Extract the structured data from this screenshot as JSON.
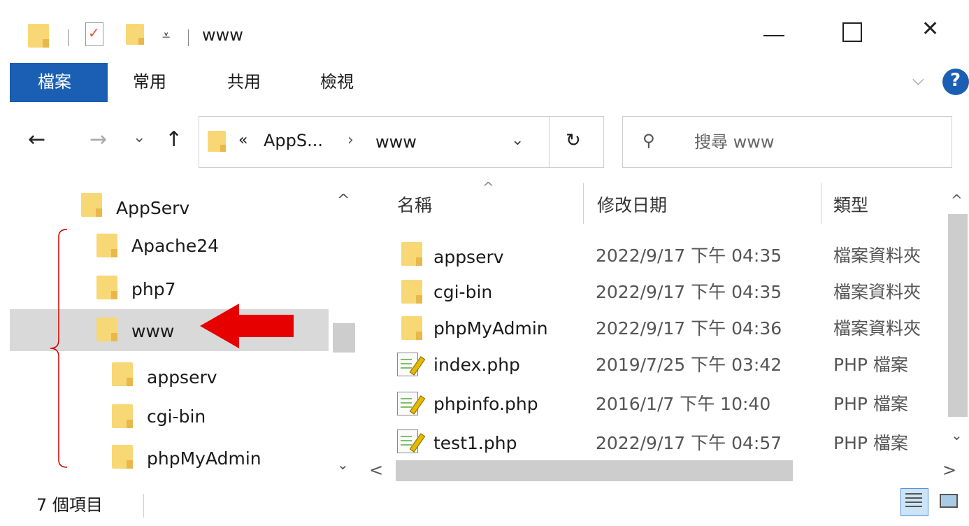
{
  "window": {
    "title": "www",
    "minimize_glyph": "—",
    "maximize_glyph": "☐",
    "close_glyph": "✕"
  },
  "ribbon": {
    "tabs": [
      "檔案",
      "常用",
      "共用",
      "檢視"
    ],
    "help_glyph": "?",
    "collapse_glyph": "⌵"
  },
  "nav": {
    "back_glyph": "←",
    "forward_glyph": "→",
    "recent_glyph": "⌄",
    "up_glyph": "↑",
    "refresh_glyph": "↻",
    "search_glyph": "⚲"
  },
  "address": {
    "overflow": "«",
    "segment1": "AppS...",
    "separator": "›",
    "segment2": "www",
    "dropdown_glyph": "⌄"
  },
  "search": {
    "placeholder": "搜尋 www"
  },
  "tree": {
    "items": [
      {
        "label": "AppServ",
        "level": 0
      },
      {
        "label": "Apache24",
        "level": 1
      },
      {
        "label": "php7",
        "level": 1
      },
      {
        "label": "www",
        "level": 1,
        "selected": true
      },
      {
        "label": "appserv",
        "level": 2
      },
      {
        "label": "cgi-bin",
        "level": 2
      },
      {
        "label": "phpMyAdmin",
        "level": 2
      }
    ],
    "scroll_up_glyph": "^",
    "scroll_down_glyph": "⌄"
  },
  "filelist": {
    "columns": {
      "name": "名稱",
      "modified": "修改日期",
      "type": "類型"
    },
    "sort_glyph": "^",
    "rows": [
      {
        "name": "appserv",
        "modified": "2022/9/17 下午 04:35",
        "type": "檔案資料夾",
        "icon": "folder"
      },
      {
        "name": "cgi-bin",
        "modified": "2022/9/17 下午 04:35",
        "type": "檔案資料夾",
        "icon": "folder"
      },
      {
        "name": "phpMyAdmin",
        "modified": "2022/9/17 下午 04:36",
        "type": "檔案資料夾",
        "icon": "folder"
      },
      {
        "name": "index.php",
        "modified": "2019/7/25 下午 03:42",
        "type": "PHP 檔案",
        "icon": "php"
      },
      {
        "name": "phpinfo.php",
        "modified": "2016/1/7 下午 10:40",
        "type": "PHP 檔案",
        "icon": "php"
      },
      {
        "name": "test1.php",
        "modified": "2022/9/17 下午 04:57",
        "type": "PHP 檔案",
        "icon": "php"
      }
    ],
    "hscroll_left_glyph": "<",
    "hscroll_right_glyph": ">",
    "vscroll_up_glyph": "^",
    "vscroll_down_glyph": "⌄"
  },
  "status": {
    "item_count": "7 個項目"
  },
  "colors": {
    "accent": "#1a5fb4",
    "selected_row": "#d9d9d9",
    "arrow": "#e60000",
    "bracket": "#cc0000"
  }
}
